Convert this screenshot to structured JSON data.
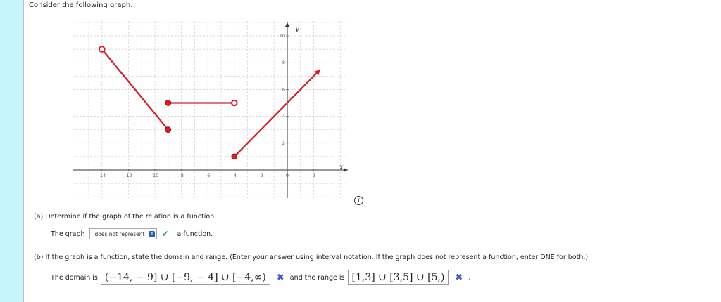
{
  "question": {
    "intro": "Consider the following graph."
  },
  "graph": {
    "x_axis_label": "x",
    "y_axis_label": "y",
    "x_ticks": [
      "-14",
      "-12",
      "-10",
      "-8",
      "-6",
      "-4",
      "-2",
      "0",
      "2"
    ],
    "y_ticks": [
      "2",
      "4",
      "6",
      "8",
      "10"
    ],
    "segments": [
      {
        "from": [
          -14,
          9
        ],
        "to": [
          -9,
          3
        ],
        "start": "open",
        "end": "closed"
      },
      {
        "from": [
          -9,
          5
        ],
        "to": [
          -4,
          5
        ],
        "start": "closed",
        "end": "open"
      },
      {
        "from": [
          -4,
          1
        ],
        "to": [
          2.5,
          7.5
        ],
        "start": "closed",
        "end": "arrow"
      }
    ],
    "colors": {
      "curve": "#d62028",
      "grid": "#cfcfcf",
      "axis": "#333333"
    }
  },
  "info_icon": "i",
  "part_a": {
    "prompt": "(a)   Determine if the graph of the relation is a function.",
    "answer_prefix": "The graph",
    "select_value": "does not represent",
    "answer_suffix": "a function.",
    "check_icon": "✔"
  },
  "part_b": {
    "prompt": "(b)   If the graph is a function, state the domain and range. (Enter your answer using interval notation. If the graph does not represent a function, enter DNE for both.)",
    "domain_label": "The domain is",
    "domain_value": "(−14, − 9] ∪ [−9, − 4] ∪ [−4,∞)",
    "range_label": "and the range is",
    "range_value": "[1,3] ∪ [3,5] ∪ [5,)",
    "x_icon": "✖",
    "end_mark": "."
  }
}
